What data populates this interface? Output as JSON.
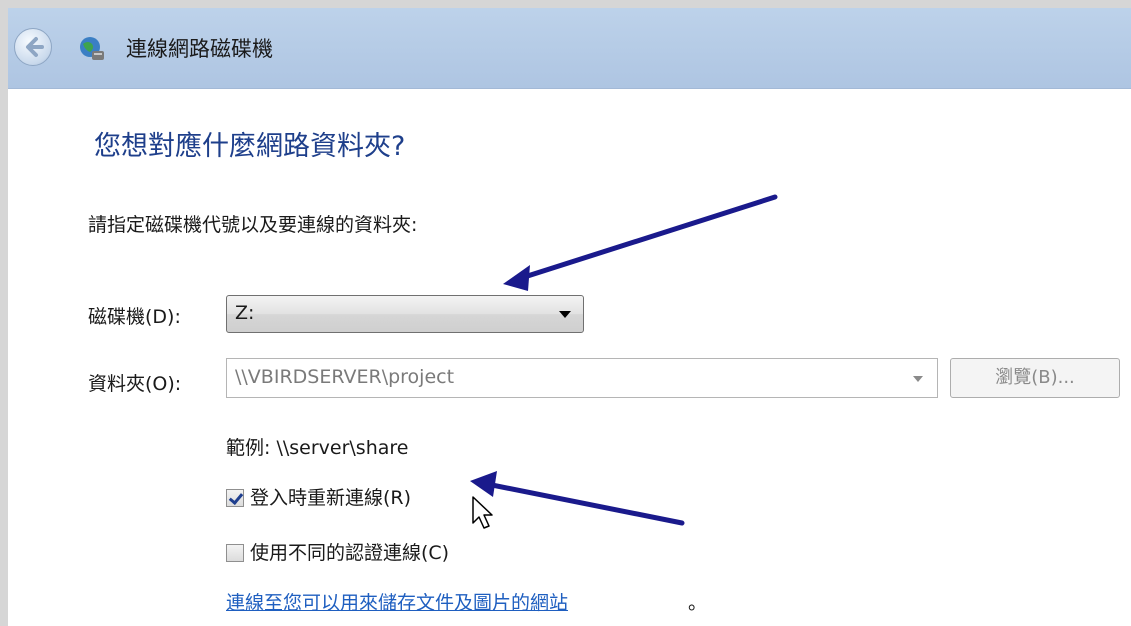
{
  "window": {
    "title": "連線網路磁碟機"
  },
  "main": {
    "heading": "您想對應什麼網路資料夾?",
    "instruction": "請指定磁碟機代號以及要連線的資料夾:",
    "drive": {
      "label": "磁碟機(D):",
      "value": "Z:"
    },
    "folder": {
      "label": "資料夾(O):",
      "value": "\\\\VBIRDSERVER\\project"
    },
    "browse_label": "瀏覽(B)...",
    "example": "範例: \\\\server\\share",
    "reconnect": {
      "label": "登入時重新連線(R)",
      "checked": true
    },
    "different_credentials": {
      "label": "使用不同的認證連線(C)",
      "checked": false
    },
    "link_text": "連線至您可以用來儲存文件及圖片的網站",
    "link_suffix": "。"
  },
  "icons": {
    "back": "back-arrow-icon",
    "network": "network-drive-icon",
    "cursor": "mouse-cursor-icon"
  },
  "colors": {
    "titlebar": "#b8cde6",
    "heading": "#1e3f8b",
    "link": "#1f5fc0",
    "annotation_arrow": "#1a1a8c"
  }
}
